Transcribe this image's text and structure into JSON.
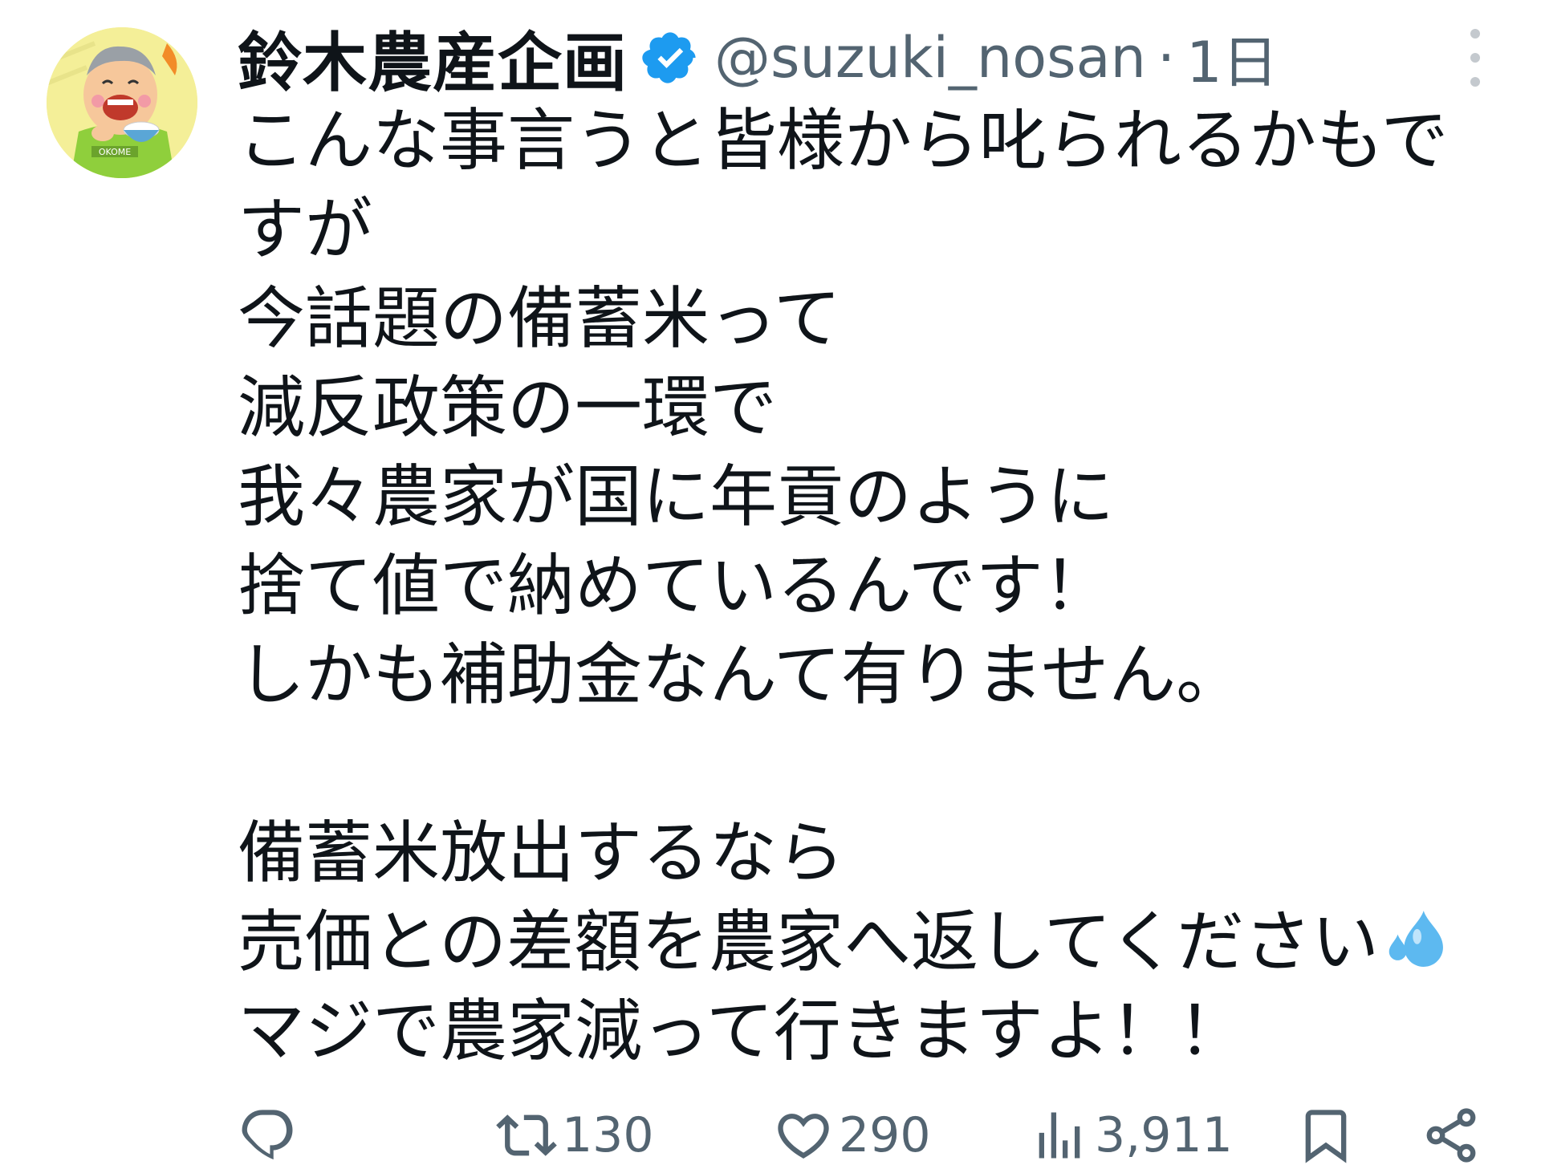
{
  "author": {
    "display_name": "鈴木農産企画",
    "handle": "@suzuki_nosan",
    "separator": "·",
    "time": "1日",
    "verified": true,
    "avatar_icon": "farmer-eating-rice-avatar",
    "avatar_text": "OKOME"
  },
  "tweet": {
    "lines": [
      "こんな事言うと皆様から叱られるかもで",
      "すが",
      "今話題の備蓄米って",
      "減反政策の一環で",
      "我々農家が国に年貢のように",
      "捨て値で納めているんです！",
      "しかも補助金なんて有りません。",
      "",
      "備蓄米放出するなら",
      "売価との差額を農家へ返してください",
      "マジで農家減って行きますよ！！"
    ],
    "emoji": "sweat-droplets-icon"
  },
  "actions": {
    "reply_icon": "reply-icon",
    "retweet_icon": "retweet-icon",
    "retweet_count": "130",
    "like_icon": "heart-icon",
    "like_count": "290",
    "views_icon": "views-icon",
    "views_count": "3,911",
    "bookmark_icon": "bookmark-icon",
    "share_icon": "share-icon"
  },
  "colors": {
    "text": "#0f1419",
    "secondary": "#536471",
    "verified": "#1d9bf0",
    "emoji": "#5db9f0"
  }
}
